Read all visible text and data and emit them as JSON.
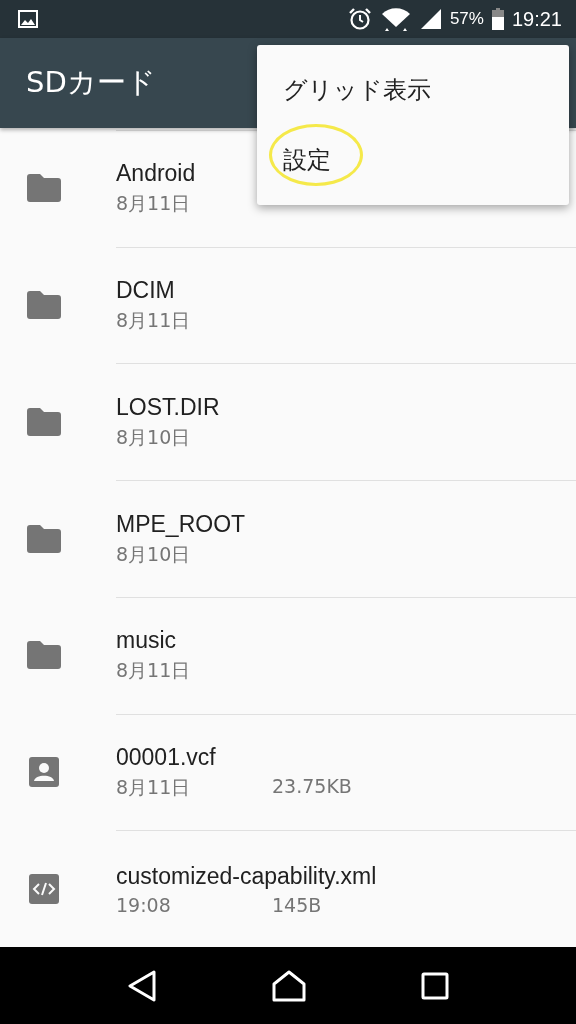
{
  "status_bar": {
    "battery_text": "57%",
    "time": "19:21"
  },
  "app_bar": {
    "title": "SDカード"
  },
  "menu": {
    "items": [
      {
        "label": "グリッド表示",
        "highlighted": false
      },
      {
        "label": "設定",
        "highlighted": true
      }
    ]
  },
  "files": [
    {
      "kind": "folder",
      "name": "Android",
      "date": "8月11日"
    },
    {
      "kind": "folder",
      "name": "DCIM",
      "date": "8月11日"
    },
    {
      "kind": "folder",
      "name": "LOST.DIR",
      "date": "8月10日"
    },
    {
      "kind": "folder",
      "name": "MPE_ROOT",
      "date": "8月10日"
    },
    {
      "kind": "folder",
      "name": "music",
      "date": "8月11日"
    },
    {
      "kind": "contact",
      "name": "00001.vcf",
      "date": "8月11日",
      "size": "23.75KB"
    },
    {
      "kind": "code",
      "name": "customized-capability.xml",
      "date": "19:08",
      "size": "145B"
    }
  ]
}
